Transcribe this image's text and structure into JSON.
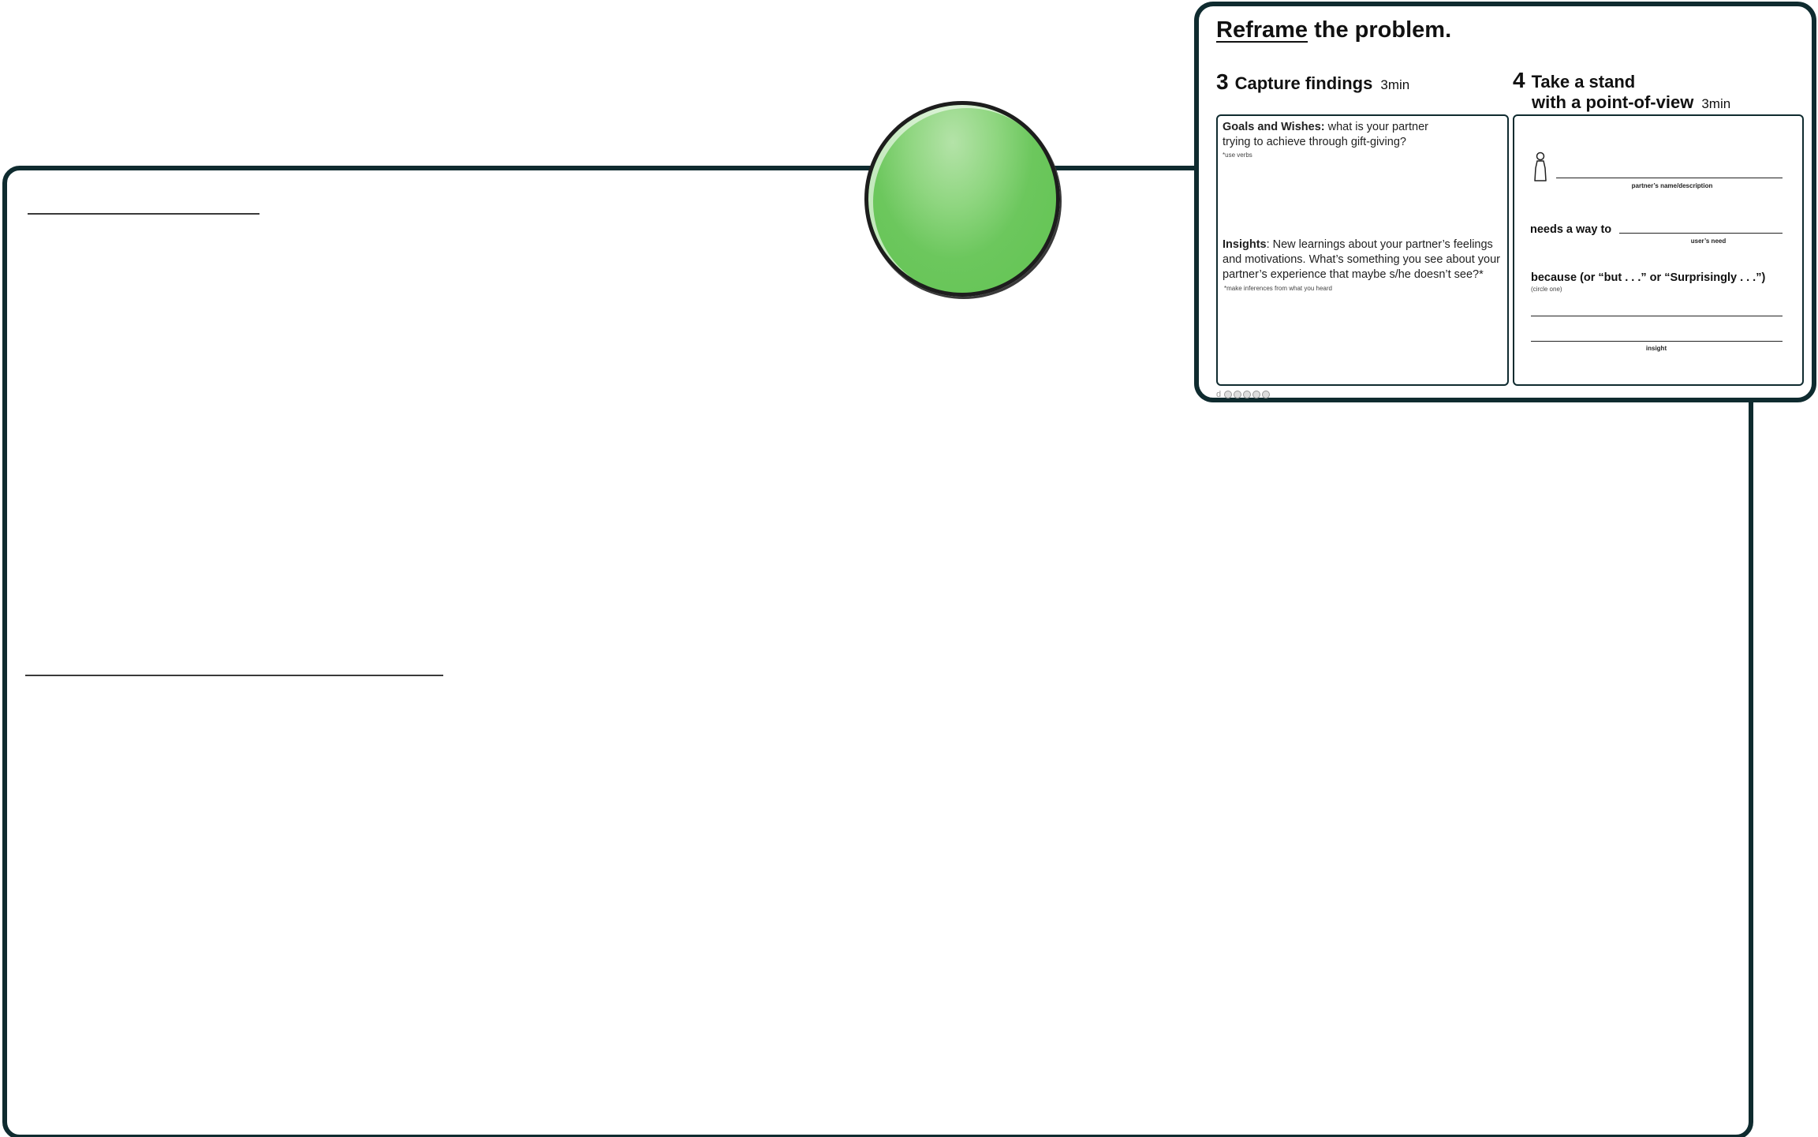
{
  "card": {
    "title_underlined": "Reframe",
    "title_rest": " the problem.",
    "section3": {
      "number": "3",
      "title": "Capture findings",
      "time": "3min",
      "goals_label": "Goals and Wishes:",
      "goals_text": " what is your partner trying to achieve through gift-giving?",
      "goals_note": "*use verbs",
      "insights_label": "Insights",
      "insights_text": ": New learnings about your partner’s feelings and motivations.  What’s something you see about your partner’s experience that maybe s/he doesn’t see?*",
      "insights_note": "*make inferences from what you heard"
    },
    "section4": {
      "number": "4",
      "title_line1": "Take a stand",
      "title_line2": "with a point-of-view",
      "time": "3min",
      "partner_caption": "partner’s name/description",
      "needs_label": "needs a way to",
      "needs_caption": "user’s need",
      "because_label": "because  (or “but . . .” or “Surprisingly . . .”)",
      "circle_note": "(circle one)",
      "insight_caption": "insight"
    },
    "logo_letter": "d"
  },
  "colors": {
    "frame": "#0f2b2f",
    "blob": "#62c452"
  }
}
